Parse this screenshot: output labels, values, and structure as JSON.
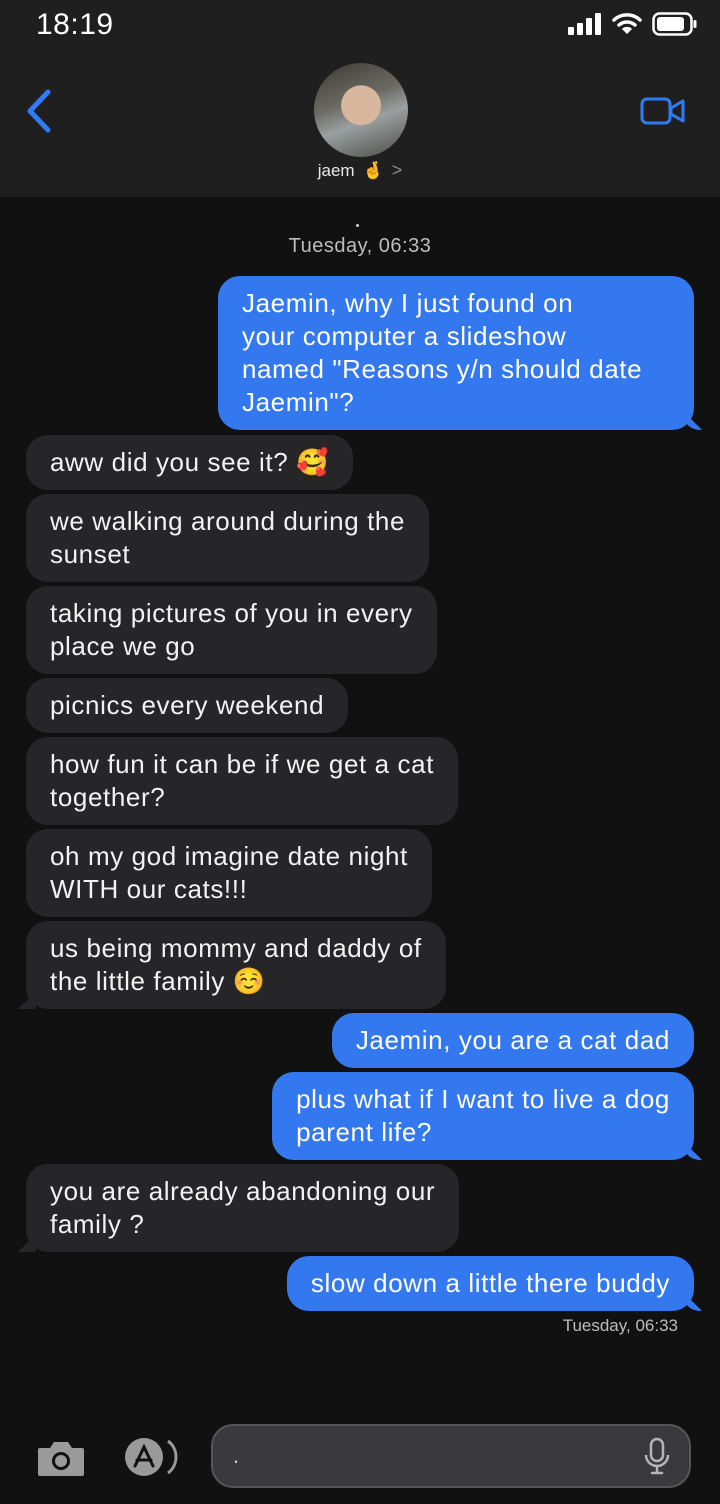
{
  "status_bar": {
    "time": "18:19"
  },
  "header": {
    "contact_name": "jaem",
    "emoji": "🤞",
    "chevron": ">"
  },
  "chat": {
    "dot": ".",
    "timestamp_top": "Tuesday, 06:33",
    "messages": [
      {
        "side": "out",
        "text": "Jaemin, why I just found on\nyour computer a slideshow\nnamed \"Reasons y/n should date\nJaemin\"?"
      },
      {
        "side": "in",
        "text": "aww did you see it? 🥰"
      },
      {
        "side": "in",
        "text": "we walking around during the\nsunset"
      },
      {
        "side": "in",
        "text": "taking pictures of you in every\nplace we go"
      },
      {
        "side": "in",
        "text": "picnics every weekend"
      },
      {
        "side": "in",
        "text": "how fun it can be if we get a cat\ntogether?"
      },
      {
        "side": "in",
        "text": "oh my god imagine date night\nWITH our cats!!!"
      },
      {
        "side": "in",
        "text": "us being mommy and daddy of\nthe little family ☺️"
      },
      {
        "side": "out",
        "text": "Jaemin, you are a cat dad"
      },
      {
        "side": "out",
        "text": "plus what if I want to live a dog\nparent life?"
      },
      {
        "side": "in",
        "text": "you are already abandoning our\nfamily ?"
      },
      {
        "side": "out",
        "text": "slow down a little there buddy"
      }
    ],
    "timestamp_bottom": "Tuesday, 06:33"
  },
  "composer": {
    "input_value": "."
  },
  "colors": {
    "outgoing": "#3478f0",
    "incoming": "#262628",
    "accent": "#2f7bf5"
  },
  "icons": [
    "signal-icon",
    "wifi-icon",
    "battery-icon",
    "back-chevron-icon",
    "video-call-icon",
    "camera-icon",
    "app-store-icon",
    "microphone-icon"
  ]
}
